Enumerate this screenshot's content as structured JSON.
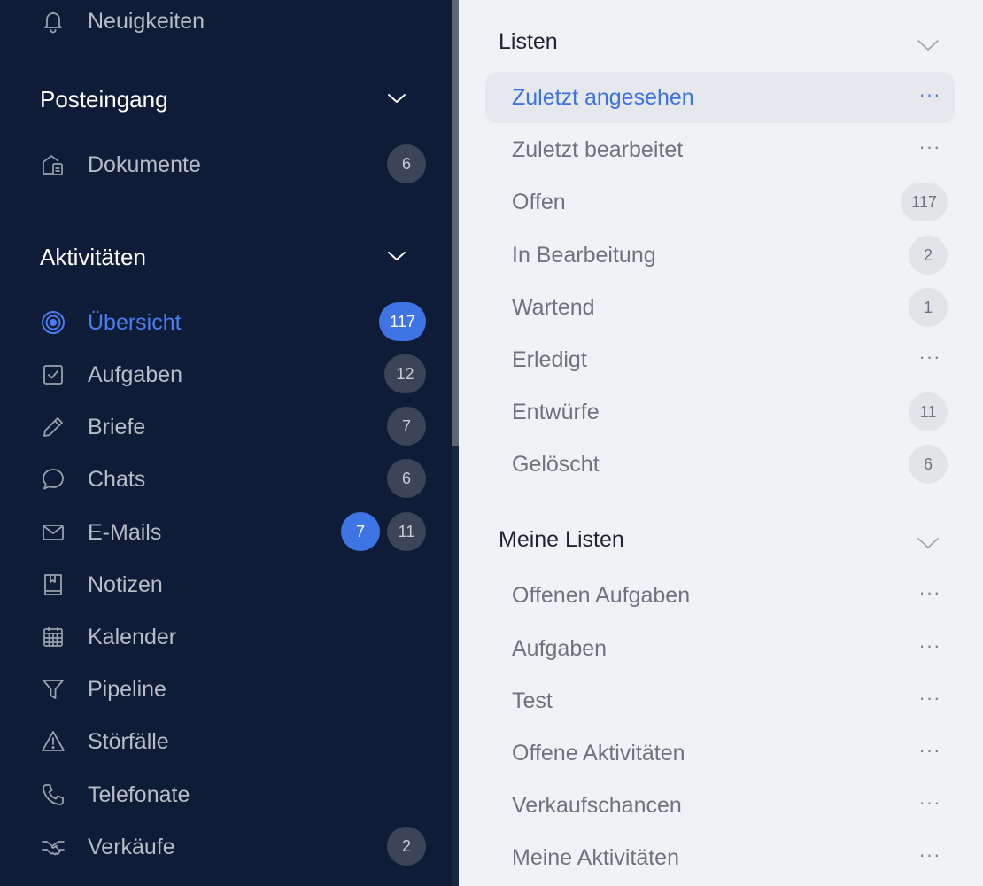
{
  "sidebar": {
    "top_item": {
      "label": "Neuigkeiten",
      "icon": "bell-icon"
    },
    "inbox_section": {
      "title": "Posteingang",
      "items": [
        {
          "label": "Dokumente",
          "count": "6",
          "icon": "documents-icon"
        }
      ]
    },
    "activities_section": {
      "title": "Aktivitäten",
      "items": [
        {
          "label": "Übersicht",
          "count": "117",
          "icon": "target-icon",
          "active": true
        },
        {
          "label": "Aufgaben",
          "count": "12",
          "icon": "checkbox-icon"
        },
        {
          "label": "Briefe",
          "count": "7",
          "icon": "pencil-icon"
        },
        {
          "label": "Chats",
          "count": "6",
          "icon": "chat-bubble-icon"
        },
        {
          "label": "E-Mails",
          "unread_count": "7",
          "count": "11",
          "icon": "mail-icon"
        },
        {
          "label": "Notizen",
          "icon": "notebook-icon"
        },
        {
          "label": "Kalender",
          "icon": "calendar-icon"
        },
        {
          "label": "Pipeline",
          "icon": "funnel-icon"
        },
        {
          "label": "Störfälle",
          "icon": "warning-icon"
        },
        {
          "label": "Telefonate",
          "icon": "phone-icon"
        },
        {
          "label": "Verkäufe",
          "count": "2",
          "icon": "handshake-icon"
        }
      ]
    }
  },
  "main": {
    "lists_section": {
      "title": "Listen",
      "items": [
        {
          "label": "Zuletzt angesehen",
          "more": "···",
          "active": true
        },
        {
          "label": "Zuletzt bearbeitet",
          "more": "···"
        },
        {
          "label": "Offen",
          "count": "117"
        },
        {
          "label": "In Bearbeitung",
          "count": "2"
        },
        {
          "label": "Wartend",
          "count": "1"
        },
        {
          "label": "Erledigt",
          "more": "···"
        },
        {
          "label": "Entwürfe",
          "count": "11"
        },
        {
          "label": "Gelöscht",
          "count": "6"
        }
      ]
    },
    "my_lists_section": {
      "title": "Meine Listen",
      "items": [
        {
          "label": "Offenen Aufgaben",
          "more": "···"
        },
        {
          "label": "Aufgaben",
          "more": "···"
        },
        {
          "label": "Test",
          "more": "···"
        },
        {
          "label": "Offene Aktivitäten",
          "more": "···"
        },
        {
          "label": "Verkaufschancen",
          "more": "···"
        },
        {
          "label": "Meine Aktivitäten",
          "more": "···"
        }
      ]
    }
  },
  "colors": {
    "sidebar_bg": "#0f1c37",
    "main_bg": "#f1f2f5",
    "accent": "#3f74e4",
    "active_text": "#4a7cf0"
  }
}
